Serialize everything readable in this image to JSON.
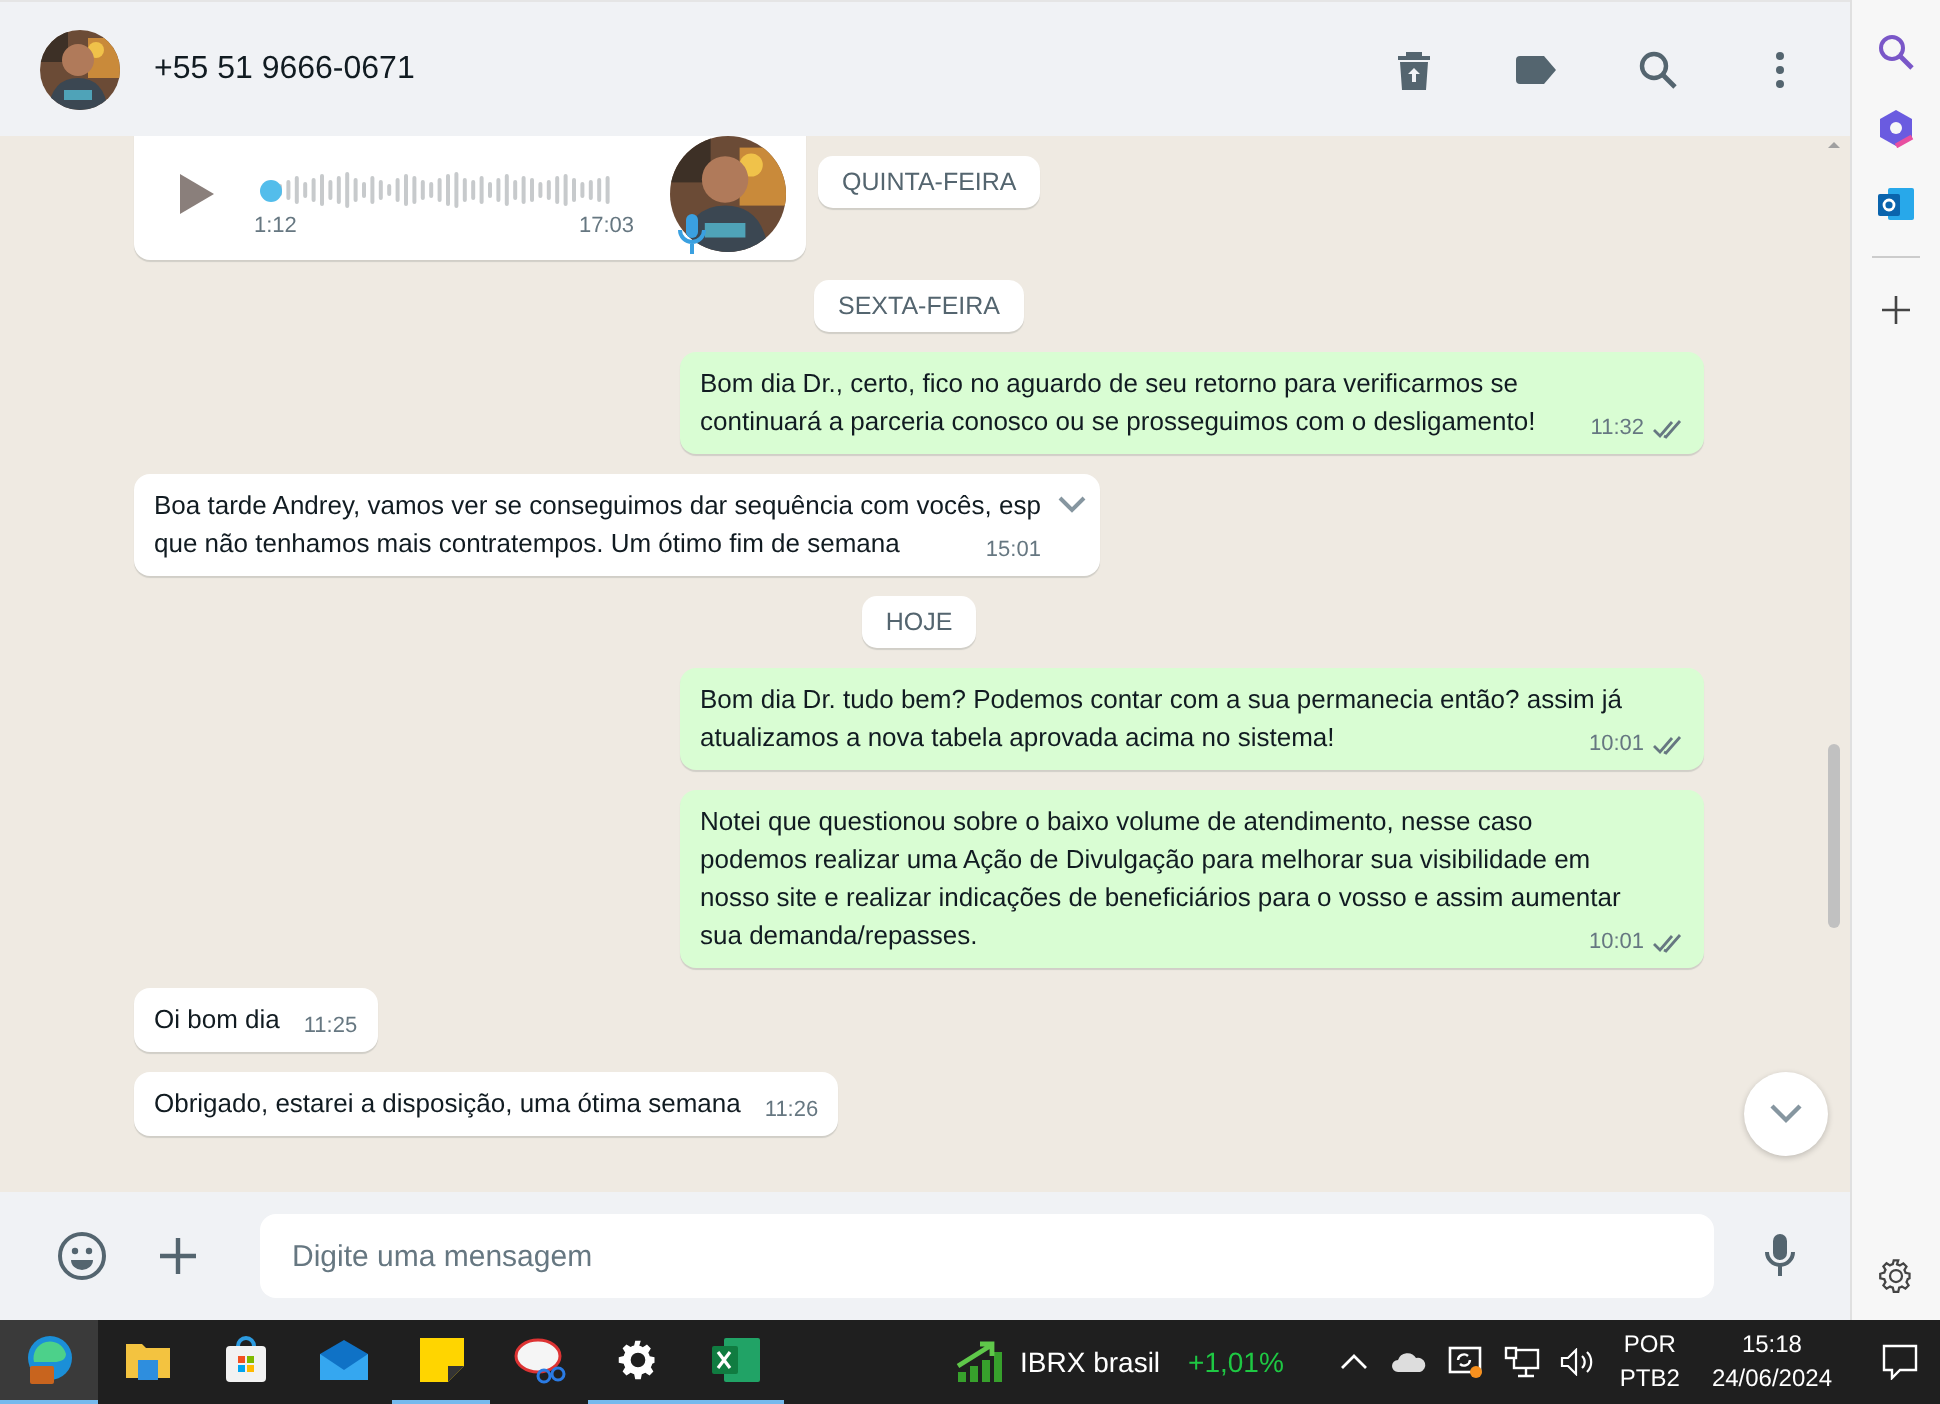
{
  "chat_header": {
    "contact": "+55 51 9666-0671"
  },
  "messages": [
    {
      "kind": "audio",
      "duration": "1:12",
      "time": "17:03",
      "chip": "QUINTA-FEIRA"
    },
    {
      "kind": "date",
      "text": "SEXTA-FEIRA"
    },
    {
      "kind": "sent",
      "text": "Bom dia Dr., certo, fico no aguardo de seu retorno para verificarmos se continuará a parceria conosco ou se prosseguimos com o desligamento!",
      "time": "11:32"
    },
    {
      "kind": "received",
      "text": "Boa tarde Andrey, vamos ver se conseguimos dar sequência com vocês, esp\nque não tenhamos mais contratempos. Um ótimo fim de semana",
      "time": "15:01",
      "hovered": true
    },
    {
      "kind": "date",
      "text": "HOJE"
    },
    {
      "kind": "sent",
      "text": "Bom dia Dr. tudo bem? Podemos contar com a sua permanecia então? assim já atualizamos a nova tabela aprovada acima no sistema!",
      "time": "10:01"
    },
    {
      "kind": "sent",
      "text": "Notei que questionou sobre o baixo volume de atendimento, nesse caso podemos realizar uma Ação de Divulgação para melhorar sua visibilidade em nosso site e realizar indicações de beneficiários para o vosso e assim aumentar sua demanda/repasses.",
      "time": "10:01"
    },
    {
      "kind": "received",
      "text": "Oi bom dia",
      "time": "11:25"
    },
    {
      "kind": "received",
      "text": "Obrigado, estarei a disposição, uma ótima semana",
      "time": "11:26"
    }
  ],
  "composer": {
    "placeholder": "Digite uma mensagem"
  },
  "taskbar": {
    "apps": [
      {
        "kind": "edge",
        "running": true,
        "selected": true
      },
      {
        "kind": "folder",
        "running": false,
        "selected": false
      },
      {
        "kind": "store",
        "running": false,
        "selected": false
      },
      {
        "kind": "mail",
        "running": false,
        "selected": false
      },
      {
        "kind": "notes",
        "running": true,
        "selected": false
      },
      {
        "kind": "snip",
        "running": false,
        "selected": false
      },
      {
        "kind": "settings",
        "running": true,
        "selected": false
      },
      {
        "kind": "excel",
        "running": true,
        "selected": false
      }
    ],
    "widget": {
      "name": "IBRX brasil",
      "change": "+1,01%"
    },
    "language": "POR",
    "layout": "PTB2",
    "time": "15:18",
    "date": "24/06/2024"
  }
}
